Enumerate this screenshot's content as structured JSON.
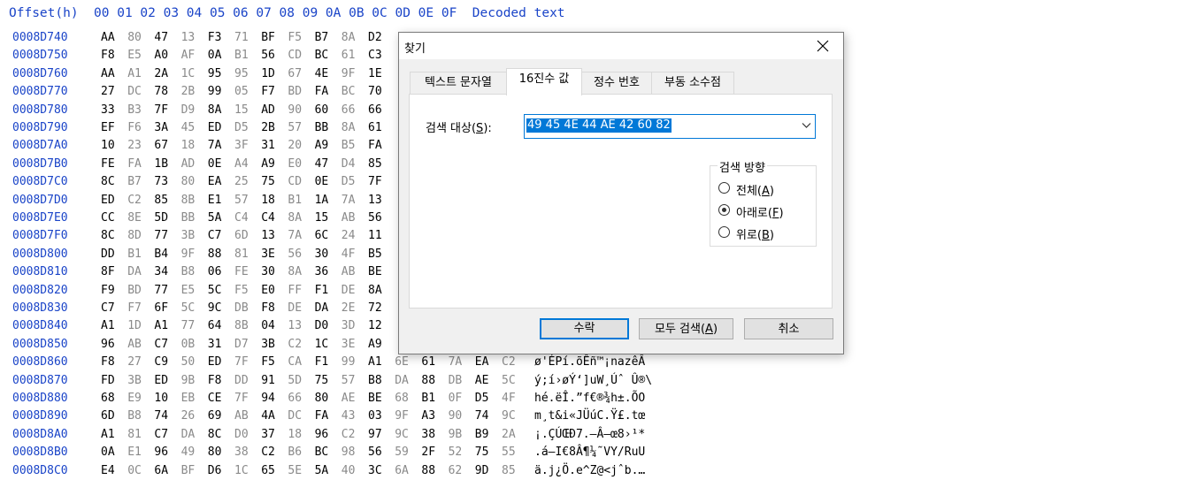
{
  "hex_header": "Offset(h)  00 01 02 03 04 05 06 07 08 09 0A 0B 0C 0D 0E 0F  Decoded text",
  "hex_rows": [
    {
      "offset": "0008D740",
      "bytes": [
        "AA",
        "80",
        "47",
        "13",
        "F3",
        "71",
        "BF",
        "F5",
        "B7",
        "8A",
        "D2"
      ],
      "text": ""
    },
    {
      "offset": "0008D750",
      "bytes": [
        "F8",
        "E5",
        "A0",
        "AF",
        "0A",
        "B1",
        "56",
        "CD",
        "BC",
        "61",
        "C3"
      ],
      "text": ""
    },
    {
      "offset": "0008D760",
      "bytes": [
        "AA",
        "A1",
        "2A",
        "1C",
        "95",
        "95",
        "1D",
        "67",
        "4E",
        "9F",
        "1E"
      ],
      "text": ""
    },
    {
      "offset": "0008D770",
      "bytes": [
        "27",
        "DC",
        "78",
        "2B",
        "99",
        "05",
        "F7",
        "BD",
        "FA",
        "BC",
        "70"
      ],
      "text": ""
    },
    {
      "offset": "0008D780",
      "bytes": [
        "33",
        "B3",
        "7F",
        "D9",
        "8A",
        "15",
        "AD",
        "90",
        "60",
        "66",
        "66"
      ],
      "text": ""
    },
    {
      "offset": "0008D790",
      "bytes": [
        "EF",
        "F6",
        "3A",
        "45",
        "ED",
        "D5",
        "2B",
        "57",
        "BB",
        "8A",
        "61"
      ],
      "text": ""
    },
    {
      "offset": "0008D7A0",
      "bytes": [
        "10",
        "23",
        "67",
        "18",
        "7A",
        "3F",
        "31",
        "20",
        "A9",
        "B5",
        "FA"
      ],
      "text": ""
    },
    {
      "offset": "0008D7B0",
      "bytes": [
        "FE",
        "FA",
        "1B",
        "AD",
        "0E",
        "A4",
        "A9",
        "E0",
        "47",
        "D4",
        "85"
      ],
      "text": ""
    },
    {
      "offset": "0008D7C0",
      "bytes": [
        "8C",
        "B7",
        "73",
        "80",
        "EA",
        "25",
        "75",
        "CD",
        "0E",
        "D5",
        "7F"
      ],
      "text": ""
    },
    {
      "offset": "0008D7D0",
      "bytes": [
        "ED",
        "C2",
        "85",
        "8B",
        "E1",
        "57",
        "18",
        "B1",
        "1A",
        "7A",
        "13"
      ],
      "text": ""
    },
    {
      "offset": "0008D7E0",
      "bytes": [
        "CC",
        "8E",
        "5D",
        "BB",
        "5A",
        "C4",
        "C4",
        "8A",
        "15",
        "AB",
        "56"
      ],
      "text": ""
    },
    {
      "offset": "0008D7F0",
      "bytes": [
        "8C",
        "8D",
        "77",
        "3B",
        "C7",
        "6D",
        "13",
        "7A",
        "6C",
        "24",
        "11"
      ],
      "text": ""
    },
    {
      "offset": "0008D800",
      "bytes": [
        "DD",
        "B1",
        "B4",
        "9F",
        "88",
        "81",
        "3E",
        "56",
        "30",
        "4F",
        "B5"
      ],
      "text": ""
    },
    {
      "offset": "0008D810",
      "bytes": [
        "8F",
        "DA",
        "34",
        "B8",
        "06",
        "FE",
        "30",
        "8A",
        "36",
        "AB",
        "BE"
      ],
      "text": ""
    },
    {
      "offset": "0008D820",
      "bytes": [
        "F9",
        "BD",
        "77",
        "E5",
        "5C",
        "F5",
        "E0",
        "FF",
        "F1",
        "DE",
        "8A"
      ],
      "text": ""
    },
    {
      "offset": "0008D830",
      "bytes": [
        "C7",
        "F7",
        "6F",
        "5C",
        "9C",
        "DB",
        "F8",
        "DE",
        "DA",
        "2E",
        "72"
      ],
      "text": ""
    },
    {
      "offset": "0008D840",
      "bytes": [
        "A1",
        "1D",
        "A1",
        "77",
        "64",
        "8B",
        "04",
        "13",
        "D0",
        "3D",
        "12"
      ],
      "text": ""
    },
    {
      "offset": "0008D850",
      "bytes": [
        "96",
        "AB",
        "C7",
        "0B",
        "31",
        "D7",
        "3B",
        "C2",
        "1C",
        "3E",
        "A9"
      ],
      "text": ""
    },
    {
      "offset": "0008D860",
      "bytes": [
        "F8",
        "27",
        "C9",
        "50",
        "ED",
        "7F",
        "F5",
        "CA",
        "F1",
        "99",
        "A1",
        "6E",
        "61",
        "7A",
        "EA",
        "C2"
      ],
      "text": "ø'ÉPí.õÊñ™¡nazêÂ"
    },
    {
      "offset": "0008D870",
      "bytes": [
        "FD",
        "3B",
        "ED",
        "9B",
        "F8",
        "DD",
        "91",
        "5D",
        "75",
        "57",
        "B8",
        "DA",
        "88",
        "DB",
        "AE",
        "5C"
      ],
      "text": "ý;í›øÝ‘]uW¸Úˆ Û®\\"
    },
    {
      "offset": "0008D880",
      "bytes": [
        "68",
        "E9",
        "10",
        "EB",
        "CE",
        "7F",
        "94",
        "66",
        "80",
        "AE",
        "BE",
        "68",
        "B1",
        "0F",
        "D5",
        "4F"
      ],
      "text": "hé.ëÎ.”f€®¾h±.ÕO"
    },
    {
      "offset": "0008D890",
      "bytes": [
        "6D",
        "B8",
        "74",
        "26",
        "69",
        "AB",
        "4A",
        "DC",
        "FA",
        "43",
        "03",
        "9F",
        "A3",
        "90",
        "74",
        "9C"
      ],
      "text": "m¸t&i«JÜúC.Ÿ£.tœ"
    },
    {
      "offset": "0008D8A0",
      "bytes": [
        "A1",
        "81",
        "C7",
        "DA",
        "8C",
        "D0",
        "37",
        "18",
        "96",
        "C2",
        "97",
        "9C",
        "38",
        "9B",
        "B9",
        "2A"
      ],
      "text": "¡.ÇÚŒÐ7.–Â—œ8›¹*"
    },
    {
      "offset": "0008D8B0",
      "bytes": [
        "0A",
        "E1",
        "96",
        "49",
        "80",
        "38",
        "C2",
        "B6",
        "BC",
        "98",
        "56",
        "59",
        "2F",
        "52",
        "75",
        "55"
      ],
      "text": ".á–I€8Â¶¼˜VY/RuU"
    },
    {
      "offset": "0008D8C0",
      "bytes": [
        "E4",
        "0C",
        "6A",
        "BF",
        "D6",
        "1C",
        "65",
        "5E",
        "5A",
        "40",
        "3C",
        "6A",
        "88",
        "62",
        "9D",
        "85"
      ],
      "text": "ä.j¿Ö.e^Z@<jˆb.…"
    }
  ],
  "dialog": {
    "title": "찾기",
    "tabs": [
      "텍스트 문자열",
      "16진수 값",
      "정수 번호",
      "부동 소수점"
    ],
    "active_tab": 1,
    "search_label_pre": "검색 대상(",
    "search_label_key": "S",
    "search_label_post": "):",
    "search_value": "49 45 4E 44 AE 42 60 82",
    "direction_group": "검색 방향",
    "radios": [
      {
        "pre": "전체(",
        "key": "A",
        "post": ")",
        "checked": false
      },
      {
        "pre": "아래로(",
        "key": "F",
        "post": ")",
        "checked": true
      },
      {
        "pre": "위로(",
        "key": "B",
        "post": ")",
        "checked": false
      }
    ],
    "buttons": {
      "ok": "수락",
      "find_all_pre": "모두 검색(",
      "find_all_key": "A",
      "find_all_post": ")",
      "cancel": "취소"
    }
  }
}
